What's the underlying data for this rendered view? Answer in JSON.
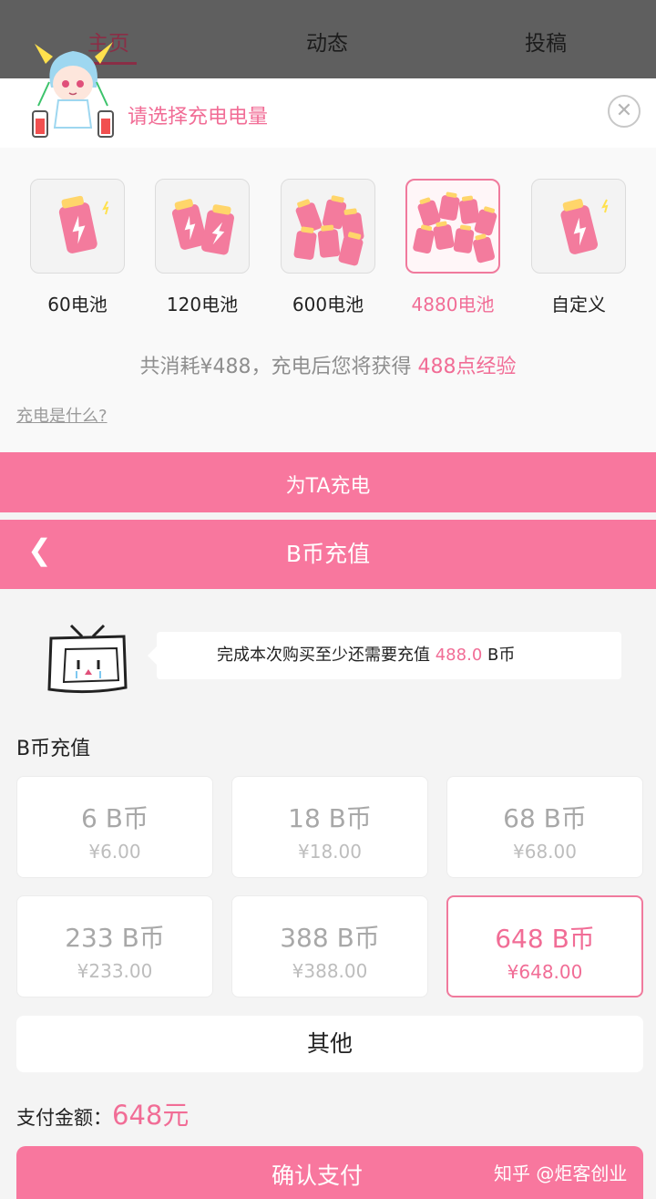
{
  "tabs": [
    {
      "label": "主页",
      "active": true
    },
    {
      "label": "动态",
      "active": false
    },
    {
      "label": "投稿",
      "active": false
    }
  ],
  "charge_sheet": {
    "title": "请选择充电电量",
    "options": [
      {
        "label": "60电池",
        "selected": false
      },
      {
        "label": "120电池",
        "selected": false
      },
      {
        "label": "600电池",
        "selected": false
      },
      {
        "label": "4880电池",
        "selected": true
      },
      {
        "label": "自定义",
        "selected": false
      }
    ],
    "summary_prefix": "共消耗",
    "summary_cost": "¥488",
    "summary_middle": "，充电后您将获得 ",
    "summary_exp": "488点经验",
    "what_link": "充电是什么?",
    "charge_button": "为TA充电"
  },
  "bcoin": {
    "back_icon": "chevron-left-icon",
    "title": "B币充值",
    "notice_prefix": "完成本次购买至少还需要充值 ",
    "notice_amount": "488.0",
    "notice_suffix": " B币",
    "section_title": "B币充值",
    "packages": [
      {
        "amount": "6 B币",
        "price": "¥6.00",
        "selected": false
      },
      {
        "amount": "18 B币",
        "price": "¥18.00",
        "selected": false
      },
      {
        "amount": "68 B币",
        "price": "¥68.00",
        "selected": false
      },
      {
        "amount": "233 B币",
        "price": "¥233.00",
        "selected": false
      },
      {
        "amount": "388 B币",
        "price": "¥388.00",
        "selected": false
      },
      {
        "amount": "648 B币",
        "price": "¥648.00",
        "selected": true
      }
    ],
    "other_button": "其他",
    "pay_label": "支付金额：",
    "pay_amount": "648元",
    "confirm_button": "确认支付"
  },
  "watermark": "知乎 @炬客创业",
  "colors": {
    "accent": "#f8779e",
    "accent_text": "#f16d96"
  }
}
